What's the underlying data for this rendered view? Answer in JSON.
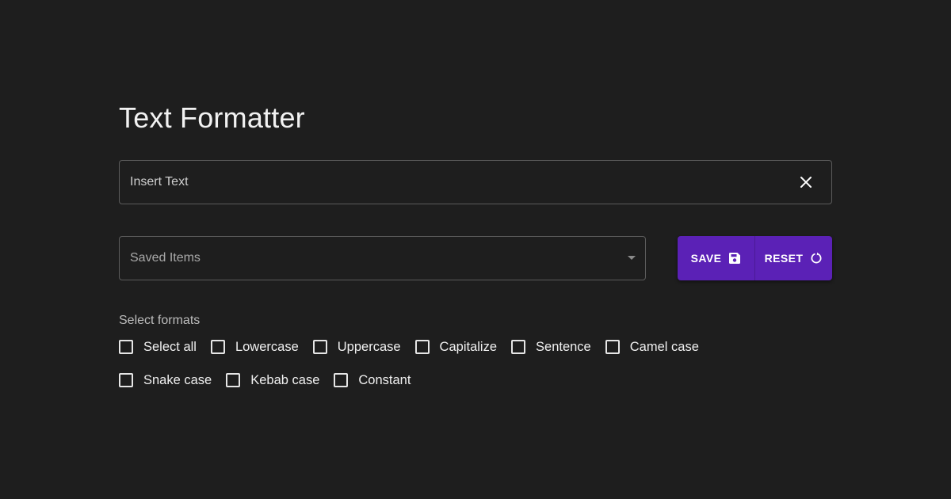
{
  "app": {
    "title": "Text Formatter"
  },
  "input": {
    "placeholder": "Insert Text",
    "value": "",
    "clear_icon": "close-icon"
  },
  "saved_items": {
    "placeholder": "Saved Items",
    "caret_icon": "caret-down-icon"
  },
  "actions": {
    "save_label": "SAVE",
    "save_icon": "floppy-disk-icon",
    "reset_label": "RESET",
    "reset_icon": "refresh-icon"
  },
  "formats": {
    "label": "Select formats",
    "options": [
      {
        "label": "Select all",
        "checked": false
      },
      {
        "label": "Lowercase",
        "checked": false
      },
      {
        "label": "Uppercase",
        "checked": false
      },
      {
        "label": "Capitalize",
        "checked": false
      },
      {
        "label": "Sentence",
        "checked": false
      },
      {
        "label": "Camel case",
        "checked": false
      },
      {
        "label": "Snake case",
        "checked": false
      },
      {
        "label": "Kebab case",
        "checked": false
      },
      {
        "label": "Constant",
        "checked": false
      }
    ]
  },
  "colors": {
    "background": "#1e1e1e",
    "accent": "#5b21b6",
    "border": "#5c5c5c",
    "text": "#ffffff"
  }
}
